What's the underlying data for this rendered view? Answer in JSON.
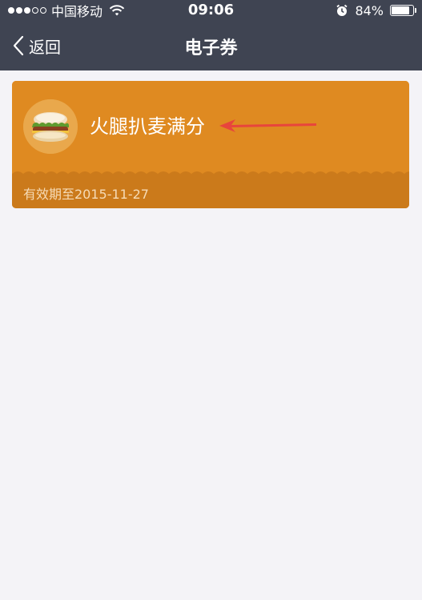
{
  "status_bar": {
    "carrier": "中国移动",
    "time": "09:06",
    "battery_percent": "84%",
    "battery_level": 0.84,
    "signal_bars_filled": 3,
    "signal_bars_total": 5,
    "icons": [
      "signal-icon",
      "wifi-icon",
      "alarm-icon",
      "battery-icon"
    ]
  },
  "nav": {
    "back_label": "返回",
    "title": "电子券"
  },
  "coupon": {
    "title": "火腿扒麦满分",
    "expiry": "有效期至2015-11-27",
    "image_icon": "burger-image",
    "annotation_icon": "red-arrow-icon",
    "colors": {
      "card": "#df8a21",
      "footer": "#cb7a1b",
      "arrow": "#e8453c"
    }
  },
  "colors": {
    "header": "#3f4452",
    "background": "#f4f3f7"
  }
}
